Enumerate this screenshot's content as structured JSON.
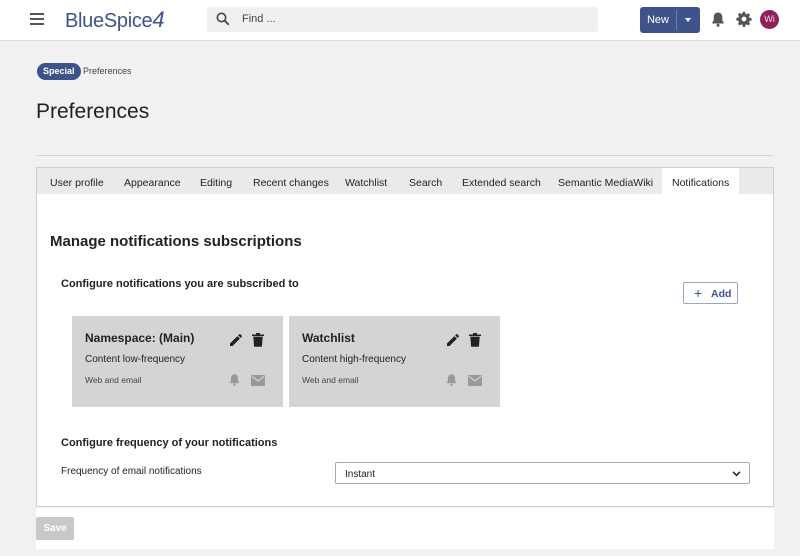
{
  "header": {
    "logo_text": "BlueSpice",
    "logo_num": "4",
    "search_placeholder": "Find ...",
    "new_label": "New",
    "avatar_initials": "Wi"
  },
  "breadcrumb": {
    "badge": "Special",
    "current": "Preferences"
  },
  "page_title": "Preferences",
  "tabs": [
    {
      "label": "User profile"
    },
    {
      "label": "Appearance"
    },
    {
      "label": "Editing"
    },
    {
      "label": "Recent changes"
    },
    {
      "label": "Watchlist"
    },
    {
      "label": "Search"
    },
    {
      "label": "Extended search"
    },
    {
      "label": "Semantic MediaWiki"
    },
    {
      "label": "Notifications",
      "active": true
    }
  ],
  "notifications": {
    "heading": "Manage notifications subscriptions",
    "subscriptions_heading": "Configure notifications you are subscribed to",
    "add_label": "Add",
    "cards": [
      {
        "title": "Namespace: (Main)",
        "subtitle": "Content low-frequency",
        "channels": "Web and email"
      },
      {
        "title": "Watchlist",
        "subtitle": "Content high-frequency",
        "channels": "Web and email"
      }
    ],
    "frequency_heading": "Configure frequency of your notifications",
    "frequency_label": "Frequency of email notifications",
    "frequency_value": "Instant"
  },
  "footer": {
    "save_label": "Save"
  },
  "colors": {
    "brand": "#3e5389",
    "avatar": "#8e2158",
    "card_bg": "#d4d4d4"
  }
}
